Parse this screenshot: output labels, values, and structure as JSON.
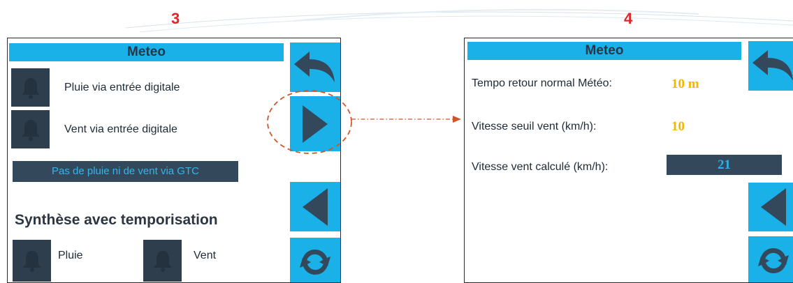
{
  "screen3": {
    "step_number": "3",
    "title": "Meteo",
    "rows": [
      {
        "label": "Pluie via entrée digitale",
        "icon": "bell-icon"
      },
      {
        "label": "Vent via entrée digitale",
        "icon": "bell-icon"
      }
    ],
    "status_text": "Pas de pluie ni de vent via GTC",
    "synthesis_heading": "Synthèse avec temporisation",
    "synthesis_items": [
      {
        "label": "Pluie",
        "icon": "bell-icon"
      },
      {
        "label": "Vent",
        "icon": "bell-icon"
      }
    ],
    "buttons": [
      "back-arrow-icon",
      "play-icon",
      "triangle-left-icon",
      "refresh-icon"
    ]
  },
  "screen4": {
    "step_number": "4",
    "title": "Meteo",
    "fields": [
      {
        "label": "Tempo retour normal Météo:",
        "value": "10 m"
      },
      {
        "label": "Vitesse seuil vent (km/h):",
        "value": "10"
      },
      {
        "label": "Vitesse vent calculé (km/h):",
        "value": "21"
      }
    ],
    "buttons": [
      "back-arrow-icon",
      "triangle-left-icon",
      "refresh-icon"
    ]
  },
  "colors": {
    "accent": "#1ab0e8",
    "dark": "#2f3e4d",
    "value_orange": "#f4b400",
    "step_red": "#e0262a",
    "connector": "#d1552a"
  }
}
